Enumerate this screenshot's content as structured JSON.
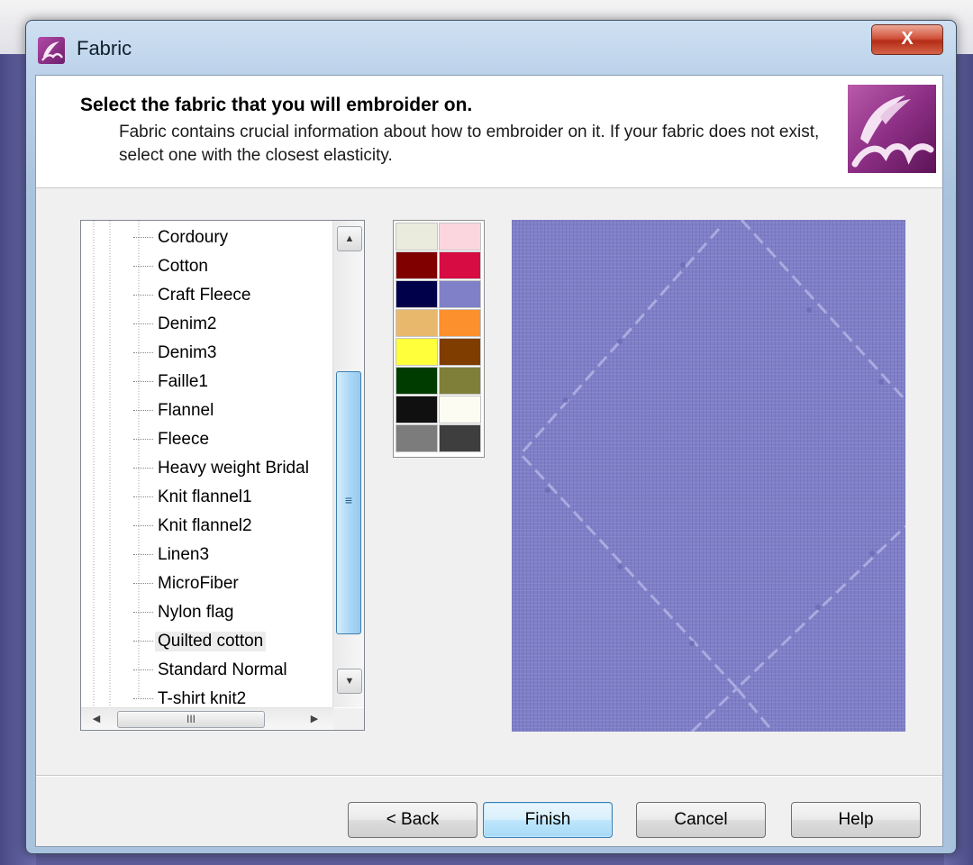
{
  "window": {
    "title": "Fabric",
    "close_symbol": "X"
  },
  "header": {
    "title": "Select the fabric that you will embroider on.",
    "description": "Fabric contains crucial information about how to embroider on it. If your fabric does not exist, select one with the closest elasticity."
  },
  "fabric_tree": {
    "items": [
      {
        "label": "Cordoury"
      },
      {
        "label": "Cotton"
      },
      {
        "label": "Craft Fleece"
      },
      {
        "label": "Denim2"
      },
      {
        "label": "Denim3"
      },
      {
        "label": "Faille1"
      },
      {
        "label": "Flannel"
      },
      {
        "label": "Fleece"
      },
      {
        "label": "Heavy weight Bridal"
      },
      {
        "label": "Knit flannel1"
      },
      {
        "label": "Knit flannel2"
      },
      {
        "label": "Linen3"
      },
      {
        "label": "MicroFiber"
      },
      {
        "label": "Nylon flag"
      },
      {
        "label": "Quilted cotton"
      },
      {
        "label": "Standard Normal"
      },
      {
        "label": "T-shirt knit2"
      }
    ],
    "selected": "Quilted cotton",
    "vscroll_grip": "≡",
    "hscroll_grip": "III"
  },
  "palette": {
    "colors": [
      "#ebebdd",
      "#fbd6de",
      "#800000",
      "#d60c42",
      "#00004a",
      "#8080c8",
      "#e8b86c",
      "#fb902c",
      "#ffff3c",
      "#7f3e00",
      "#003c00",
      "#7f7f3a",
      "#101010",
      "#fcfcf2",
      "#7c7c7c",
      "#3e3e3e"
    ]
  },
  "preview": {
    "fabric_color": "#7f7fc8",
    "stitch_color": "#b8b8e8"
  },
  "buttons": {
    "back": "< Back",
    "finish": "Finish",
    "cancel": "Cancel",
    "help": "Help"
  }
}
